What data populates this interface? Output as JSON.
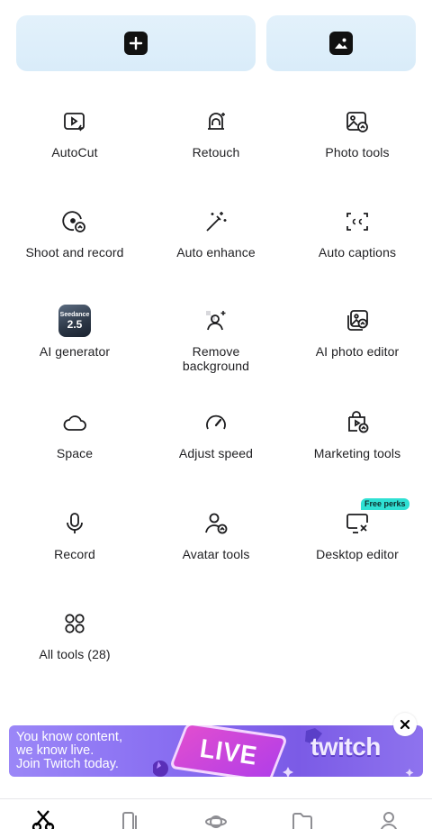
{
  "top_actions": {
    "new_project_icon": "plus-square-icon",
    "photo_icon": "image-square-icon"
  },
  "tools": [
    {
      "label": "AutoCut",
      "icon": "autocut-icon"
    },
    {
      "label": "Retouch",
      "icon": "retouch-icon"
    },
    {
      "label": "Photo tools",
      "icon": "photo-tools-icon"
    },
    {
      "label": "Shoot and record",
      "icon": "shoot-record-icon"
    },
    {
      "label": "Auto enhance",
      "icon": "magic-wand-icon"
    },
    {
      "label": "Auto captions",
      "icon": "captions-icon"
    },
    {
      "label": "AI generator",
      "icon": "seedance-icon",
      "thumb_top": "Seedance",
      "thumb_version": "2.5"
    },
    {
      "label": "Remove\nbackground",
      "icon": "remove-background-icon"
    },
    {
      "label": "AI photo editor",
      "icon": "ai-photo-editor-icon"
    },
    {
      "label": "Space",
      "icon": "cloud-icon"
    },
    {
      "label": "Adjust speed",
      "icon": "speedometer-icon"
    },
    {
      "label": "Marketing tools",
      "icon": "marketing-bag-icon"
    },
    {
      "label": "Record",
      "icon": "microphone-icon"
    },
    {
      "label": "Avatar tools",
      "icon": "avatar-icon"
    },
    {
      "label": "Desktop editor",
      "icon": "desktop-icon",
      "badge": "Free perks"
    },
    {
      "label": "All tools (28)",
      "icon": "grid-circles-icon"
    }
  ],
  "banner": {
    "text": "You know content,\nwe know live.\nJoin Twitch today.",
    "live_text": "LIVE",
    "brand_text": "twitch",
    "close_icon": "close-icon"
  },
  "bottom_nav": [
    "edit-scissors-icon",
    "templates-icon",
    "explore-icon",
    "files-icon",
    "profile-icon"
  ],
  "colors": {
    "top_button_bg": "#dcedf9",
    "badge_bg": "#2fe0d3",
    "banner_purple": "#8a70f2"
  }
}
